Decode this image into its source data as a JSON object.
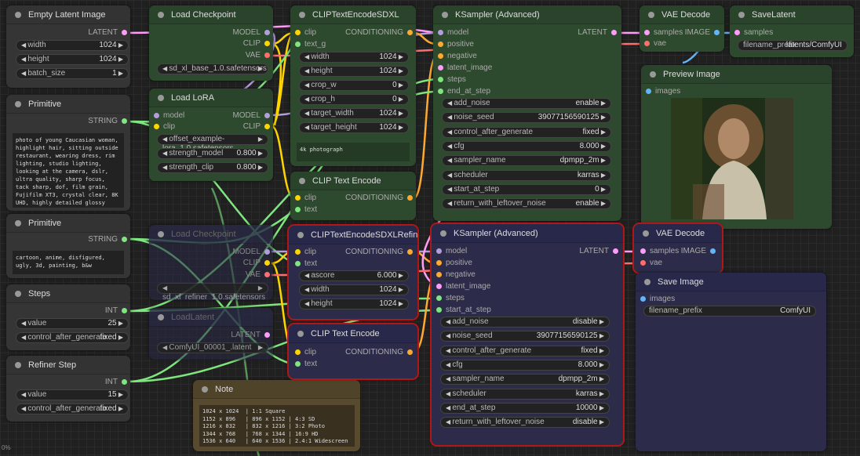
{
  "latent": {
    "title": "Empty Latent Image",
    "out": "LATENT",
    "width_l": "width",
    "width_v": "1024",
    "height_l": "height",
    "height_v": "1024",
    "batch_l": "batch_size",
    "batch_v": "1"
  },
  "ckpt": {
    "title": "Load Checkpoint",
    "o1": "MODEL",
    "o2": "CLIP",
    "o3": "VAE",
    "ckpt": "sd_xl_base_1.0.safetensors"
  },
  "lora": {
    "title": "Load LoRA",
    "i1": "model",
    "i2": "clip",
    "o1": "MODEL",
    "o2": "CLIP",
    "name": "offset_example-lora_1.0.safetensors",
    "sm_l": "strength_model",
    "sm_v": "0.800",
    "sc_l": "strength_clip",
    "sc_v": "0.800"
  },
  "prim1": {
    "title": "Primitive",
    "out": "STRING",
    "text": "photo of young Caucasian woman, highlight hair, sitting outside restaurant, wearing dress, rim lighting, studio lighting, looking at the camera, dslr, ultra quality, sharp focus, tack sharp, dof, film grain, Fujifilm XT3, crystal clear, 8K UHD, highly detailed glossy eyes, high detailed skin, skin pores"
  },
  "prim2": {
    "title": "Primitive",
    "out": "STRING",
    "text": "cartoon, anime, disfigured, ugly, 3d, painting, b&w"
  },
  "steps": {
    "title": "Steps",
    "out": "INT",
    "v_l": "value",
    "v_v": "25",
    "c_l": "control_after_generate",
    "c_v": "fixed"
  },
  "refsteps": {
    "title": "Refiner Step",
    "out": "INT",
    "v_l": "value",
    "v_v": "15",
    "c_l": "control_after_generate",
    "c_v": "fixed"
  },
  "ckpt2": {
    "title": "Load Checkpoint",
    "o1": "MODEL",
    "o2": "CLIP",
    "o3": "VAE",
    "ckpt": "sd_xl_refiner_1.0.safetensors"
  },
  "loadlatent": {
    "title": "LoadLatent",
    "out": "LATENT",
    "file": "ComfyUI_00001_.latent"
  },
  "cliptxl": {
    "title": "CLIPTextEncodeSDXL",
    "i1": "clip",
    "i2": "text_g",
    "out": "CONDITIONING",
    "w_l": "width",
    "w_v": "1024",
    "h_l": "height",
    "h_v": "1024",
    "cw_l": "crop_w",
    "cw_v": "0",
    "ch_l": "crop_h",
    "ch_v": "0",
    "tw_l": "target_width",
    "tw_v": "1024",
    "th_l": "target_height",
    "th_v": "1024",
    "text": "4k photograph"
  },
  "clip1": {
    "title": "CLIP Text Encode",
    "i1": "clip",
    "i2": "text",
    "out": "CONDITIONING"
  },
  "refenc": {
    "title": "CLIPTextEncodeSDXLRefiner",
    "i1": "clip",
    "i2": "text",
    "out": "CONDITIONING",
    "a_l": "ascore",
    "a_v": "6.000",
    "w_l": "width",
    "w_v": "1024",
    "h_l": "height",
    "h_v": "1024"
  },
  "clip2": {
    "title": "CLIP Text Encode",
    "i1": "clip",
    "i2": "text",
    "out": "CONDITIONING"
  },
  "note": {
    "title": "Note",
    "text": "1024 x 1024  | 1:1 Square\n1152 x 896   | 896 x 1152 | 4:3 SD\n1216 x 832   | 832 x 1216 | 3:2 Photo\n1344 x 768   | 768 x 1344 | 16:9 HD\n1536 x 640   | 640 x 1536 | 2.4:1 Widescreen"
  },
  "ks1": {
    "title": "KSampler (Advanced)",
    "in": [
      "model",
      "positive",
      "negative",
      "latent_image",
      "steps",
      "end_at_step"
    ],
    "out": "LATENT",
    "w": [
      [
        "add_noise",
        "enable"
      ],
      [
        "noise_seed",
        "390771565901​25"
      ],
      [
        "control_after_generate",
        "fixed"
      ],
      [
        "cfg",
        "8.000"
      ],
      [
        "sampler_name",
        "dpmpp_2m"
      ],
      [
        "scheduler",
        "karras"
      ],
      [
        "start_at_step",
        "0"
      ],
      [
        "return_with_leftover_noise",
        "enable"
      ]
    ]
  },
  "ks2": {
    "title": "KSampler (Advanced)",
    "in": [
      "model",
      "positive",
      "negative",
      "latent_image",
      "steps",
      "start_at_step"
    ],
    "out": "LATENT",
    "w": [
      [
        "add_noise",
        "disable"
      ],
      [
        "noise_seed",
        "390771565901​25"
      ],
      [
        "control_after_generate",
        "fixed"
      ],
      [
        "cfg",
        "8.000"
      ],
      [
        "sampler_name",
        "dpmpp_2m"
      ],
      [
        "scheduler",
        "karras"
      ],
      [
        "end_at_step",
        "10000"
      ],
      [
        "return_with_leftover_noise",
        "disable"
      ]
    ]
  },
  "vae1": {
    "title": "VAE Decode",
    "i1": "samples",
    "i2": "vae",
    "out": "IMAGE"
  },
  "vae2": {
    "title": "VAE Decode",
    "i1": "samples",
    "i2": "vae",
    "out": "IMAGE"
  },
  "savelat": {
    "title": "SaveLatent",
    "i1": "samples",
    "fp_l": "filename_prefix",
    "fp_v": "latents/ComfyUI"
  },
  "preview": {
    "title": "Preview Image",
    "i1": "images"
  },
  "saveimg": {
    "title": "Save Image",
    "i1": "images",
    "fp_l": "filename_prefix",
    "fp_v": "ComfyUI"
  },
  "status": "0%",
  "colors": {
    "model": "#b39ddb",
    "clip": "#ffd500",
    "vae": "#ff6e6e",
    "latent": "#ff9cf9",
    "cond": "#ffa931",
    "string": "#7fe57f",
    "image": "#64b5f6"
  }
}
